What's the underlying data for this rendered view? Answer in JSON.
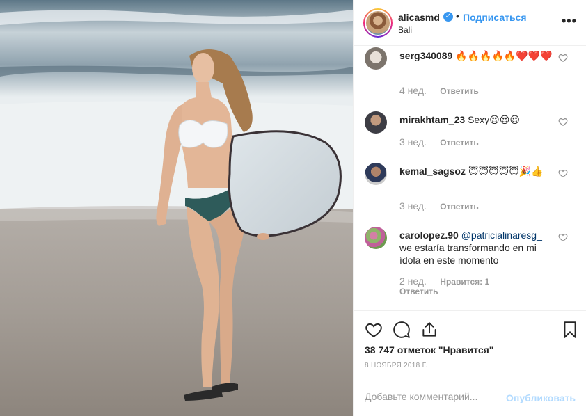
{
  "post": {
    "username": "alicasmd",
    "follow_label": "Подписаться",
    "dot": "•",
    "location": "Bali",
    "more_label": "•••"
  },
  "comments": [
    {
      "user": "serg340089",
      "text": "🔥🔥🔥🔥🔥❤️❤️❤️",
      "time": "4 нед.",
      "reply": "Ответить"
    },
    {
      "user": "mirakhtam_23",
      "text": "Sexy😍😍😍",
      "time": "3 нед.",
      "reply": "Ответить"
    },
    {
      "user": "kemal_sagsoz",
      "text": "😇😇😇😇😇🎉👍",
      "time": "3 нед.",
      "reply": "Ответить"
    },
    {
      "user": "carolopez.90",
      "mention": "@patricialinaresg_",
      "text": "we estaría transformando en mi ídola en este momento",
      "time": "2 нед.",
      "likes": "Нравится: 1",
      "reply": "Ответить"
    }
  ],
  "actions": {
    "likes_text": "38 747 отметок \"Нравится\"",
    "date": "8 НОЯБРЯ 2018 Г."
  },
  "add_comment": {
    "placeholder": "Добавьте комментарий...",
    "publish_label": "Опубликовать"
  },
  "colors": {
    "link_blue": "#3897f0",
    "publish_disabled": "#b3dbff",
    "muted": "#999999"
  },
  "icons": [
    "verified-badge-icon",
    "more-options-icon",
    "heart-icon",
    "comment-icon",
    "share-icon",
    "bookmark-icon"
  ]
}
